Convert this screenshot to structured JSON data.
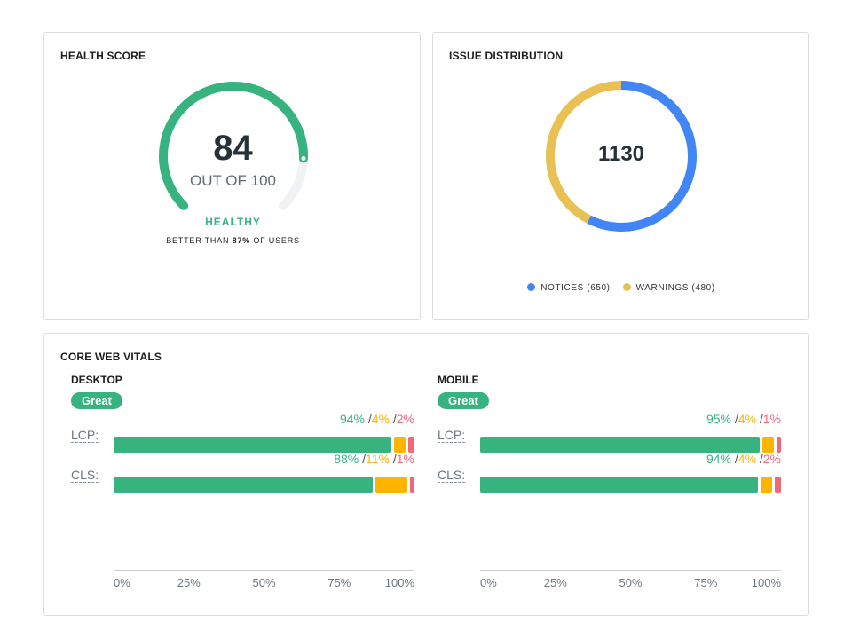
{
  "health": {
    "title": "HEALTH SCORE",
    "score": 84,
    "score_text": "84",
    "out_of": "OUT OF 100",
    "status": "HEALTHY",
    "better_prefix": "BETTER THAN",
    "better_pct": "87%",
    "better_suffix": "OF USERS",
    "color": "#36b37e"
  },
  "issues": {
    "title": "ISSUE DISTRIBUTION",
    "total": "1130",
    "segments": [
      {
        "label": "NOTICES (650)",
        "value": 650,
        "color": "#4285f4"
      },
      {
        "label": "WARNINGS (480)",
        "value": 480,
        "color": "#e9c053"
      }
    ]
  },
  "vitals": {
    "title": "CORE WEB VITALS",
    "colors": {
      "good": "#36b37e",
      "mid": "#ffb400",
      "bad": "#f0697a"
    },
    "ticks": [
      "0%",
      "25%",
      "50%",
      "75%",
      "100%"
    ],
    "panels": [
      {
        "name": "DESKTOP",
        "badge": "Great",
        "rows": [
          {
            "metric": "LCP:",
            "good": 94,
            "mid": 4,
            "bad": 2,
            "good_t": "94%",
            "mid_t": "4%",
            "bad_t": "2%"
          },
          {
            "metric": "CLS:",
            "good": 88,
            "mid": 11,
            "bad": 1,
            "good_t": "88%",
            "mid_t": "11%",
            "bad_t": "1%"
          }
        ]
      },
      {
        "name": "MOBILE",
        "badge": "Great",
        "rows": [
          {
            "metric": "LCP:",
            "good": 95,
            "mid": 4,
            "bad": 1,
            "good_t": "95%",
            "mid_t": "4%",
            "bad_t": "1%"
          },
          {
            "metric": "CLS:",
            "good": 94,
            "mid": 4,
            "bad": 2,
            "good_t": "94%",
            "mid_t": "4%",
            "bad_t": "2%"
          }
        ]
      }
    ]
  }
}
